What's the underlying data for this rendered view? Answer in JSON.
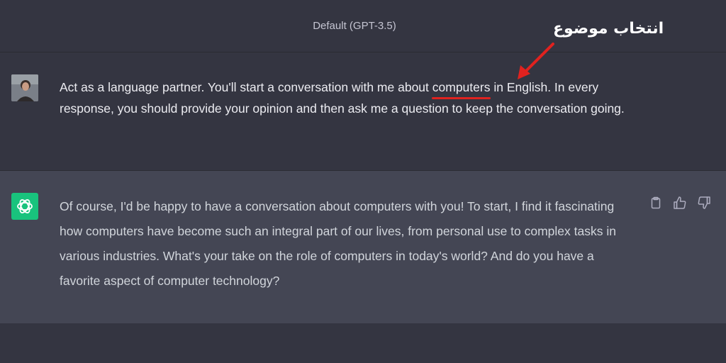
{
  "header": {
    "model": "Default (GPT-3.5)"
  },
  "annotation": {
    "text": "انتخاب موضوع",
    "color": "#e0221f"
  },
  "user_message": {
    "text_before": "Act as a language partner. You'll start a conversation with me about ",
    "highlighted_word": "computers",
    "text_after": " in English. In every response, you should provide your opinion and then ask me a question to keep the conversation going."
  },
  "assistant_message": {
    "text": "Of course, I'd be happy to have a conversation about computers with you! To start, I find it fascinating how computers have become such an integral part of our lives, from personal use to complex tasks in various industries. What's your take on the role of computers in today's world? And do you have a favorite aspect of computer technology?",
    "actions": [
      "clipboard-icon",
      "thumbs-up-icon",
      "thumbs-down-icon"
    ]
  },
  "colors": {
    "background": "#343541",
    "assistant_background": "#444654",
    "gpt_brand": "#19c37d"
  }
}
